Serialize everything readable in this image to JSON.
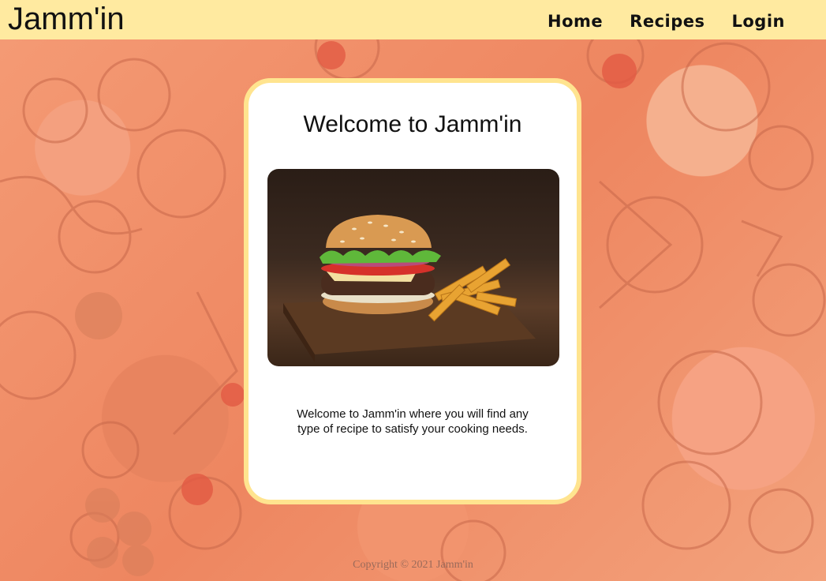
{
  "header": {
    "brand": "Jamm'in",
    "nav": [
      {
        "label": "Home"
      },
      {
        "label": "Recipes"
      },
      {
        "label": "Login"
      }
    ]
  },
  "main": {
    "title": "Welcome to Jamm'in",
    "image_alt": "burger-and-fries-photo",
    "description": "Welcome to Jamm'in where you will find any type of recipe to satisfy your cooking needs."
  },
  "footer": {
    "copyright": "Copyright © 2021 Jamm'in"
  },
  "colors": {
    "header_bg": "#ffeaa0",
    "card_border": "#ffe48f",
    "background": "#f08a5d"
  }
}
